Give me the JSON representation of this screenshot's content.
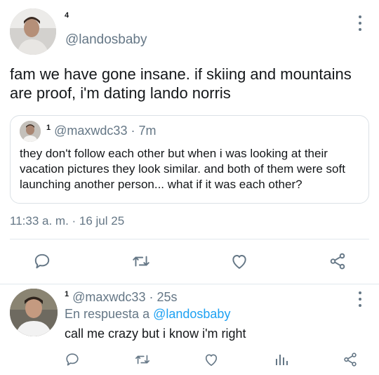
{
  "main_tweet": {
    "author_badge": "4",
    "handle": "@landosbaby",
    "text": "fam we have gone insane. if skiing and mountains are proof, i'm dating lando norris",
    "quote": {
      "author_badge": "1",
      "handle": "@maxwdc33",
      "age": "· 7m",
      "text": "they don't follow each other but when i was looking at their vacation pictures they look similar. and both of them were soft launching another person... what if it was each other?"
    },
    "timestamp": "11:33 a. m. · 16 jul 25"
  },
  "reply": {
    "author_badge": "1",
    "handle": "@maxwdc33",
    "age": "· 25s",
    "reply_prefix": "En respuesta a",
    "reply_to": "@landosbaby",
    "text": "call me crazy but i know i'm right"
  },
  "colors": {
    "icon_gray": "#657786",
    "link_blue": "#1da1f2",
    "divider": "#e1e8ed"
  },
  "icons": [
    "reply-icon",
    "retweet-icon",
    "like-icon",
    "share-icon",
    "analytics-icon",
    "more-icon"
  ]
}
